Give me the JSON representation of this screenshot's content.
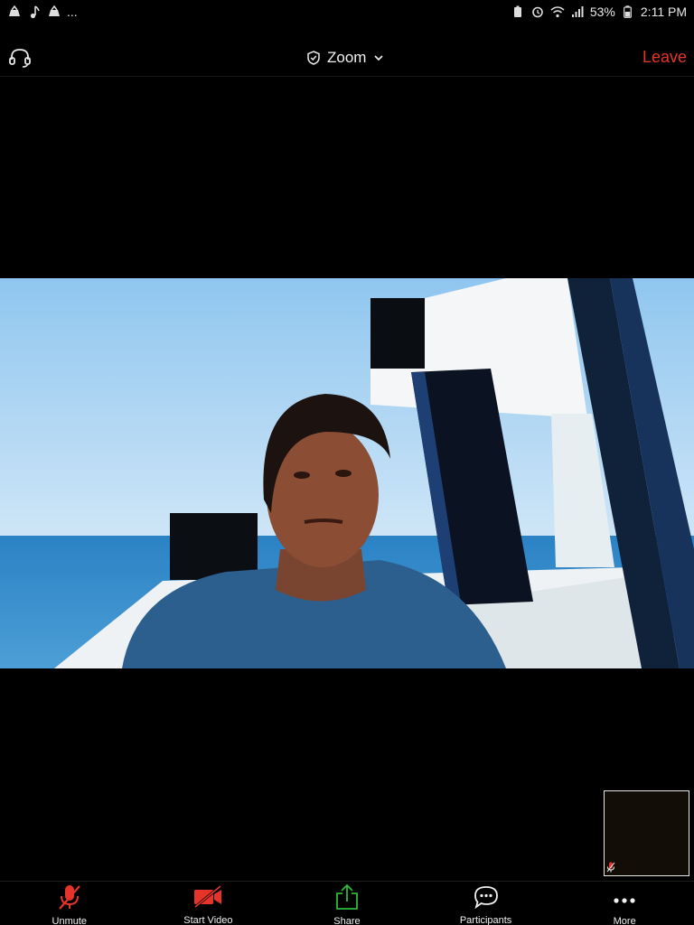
{
  "status_bar": {
    "overflow_text": "...",
    "battery_percent": "53%",
    "time": "2:11 PM",
    "left_icons": [
      "app-notification-icon",
      "music-note-icon",
      "app-notification-icon"
    ],
    "right_icons": [
      "battery-saver-icon",
      "alarm-icon",
      "wifi-icon",
      "signal-icon",
      "battery-icon"
    ]
  },
  "toolbar": {
    "meeting_title": "Zoom",
    "leave_label": "Leave",
    "leave_color": "#e5352b"
  },
  "bottom_toolbar": {
    "unmute_label": "Unmute",
    "start_video_label": "Start Video",
    "share_label": "Share",
    "participants_label": "Participants",
    "more_label": "More",
    "muted_color": "#e5352b",
    "share_color": "#2dbb3d"
  },
  "self_view": {
    "muted": true
  }
}
